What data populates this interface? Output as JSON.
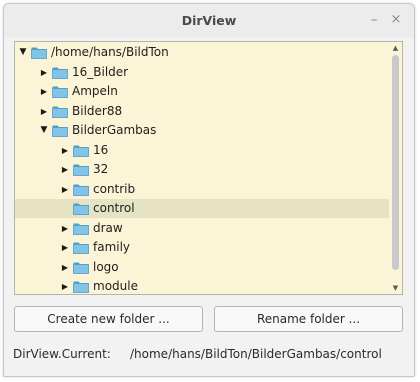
{
  "window": {
    "title": "DirView",
    "minimize_glyph": "–",
    "close_glyph": "×"
  },
  "tree": {
    "items": [
      {
        "label": "/home/hans/BildTon",
        "level": 0,
        "expanded": true,
        "has_children": true,
        "selected": false
      },
      {
        "label": "16_Bilder",
        "level": 1,
        "expanded": false,
        "has_children": true,
        "selected": false
      },
      {
        "label": "Ampeln",
        "level": 1,
        "expanded": false,
        "has_children": true,
        "selected": false
      },
      {
        "label": "Bilder88",
        "level": 1,
        "expanded": false,
        "has_children": true,
        "selected": false
      },
      {
        "label": "BilderGambas",
        "level": 1,
        "expanded": true,
        "has_children": true,
        "selected": false
      },
      {
        "label": "16",
        "level": 2,
        "expanded": false,
        "has_children": true,
        "selected": false
      },
      {
        "label": "32",
        "level": 2,
        "expanded": false,
        "has_children": true,
        "selected": false
      },
      {
        "label": "contrib",
        "level": 2,
        "expanded": false,
        "has_children": true,
        "selected": false
      },
      {
        "label": "control",
        "level": 2,
        "expanded": false,
        "has_children": false,
        "selected": true
      },
      {
        "label": "draw",
        "level": 2,
        "expanded": false,
        "has_children": true,
        "selected": false
      },
      {
        "label": "family",
        "level": 2,
        "expanded": false,
        "has_children": true,
        "selected": false
      },
      {
        "label": "logo",
        "level": 2,
        "expanded": false,
        "has_children": true,
        "selected": false
      },
      {
        "label": "module",
        "level": 2,
        "expanded": false,
        "has_children": true,
        "selected": false
      }
    ]
  },
  "buttons": {
    "create": "Create new folder ...",
    "rename": "Rename folder ..."
  },
  "status": {
    "label": "DirView.Current:",
    "value": "/home/hans/BildTon/BilderGambas/control"
  },
  "colors": {
    "tree_background": "#fcf4d6",
    "selected_row": "#e6e2c4",
    "folder_fill": "#82c4e8",
    "folder_dark": "#4f9cc8"
  }
}
